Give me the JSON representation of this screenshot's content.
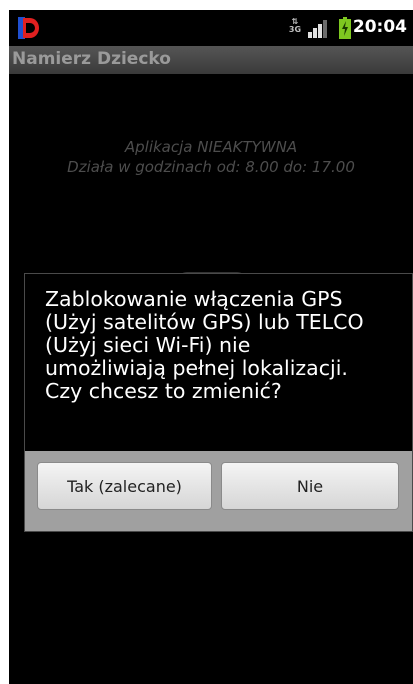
{
  "status_bar": {
    "clock": "20:04",
    "network_label": "3G",
    "icons": [
      "app-notification-icon",
      "3g-data-icon",
      "signal-strength-icon",
      "battery-charging-icon"
    ]
  },
  "title_bar": {
    "title": "Namierz Dziecko"
  },
  "app_content": {
    "status_line_1": "Aplikacja NIEAKTYWNA",
    "status_line_2": "Działa w godzinach od: 8.00 do: 17.00"
  },
  "dialog": {
    "message": "Zablokowanie włączenia GPS\n(Użyj satelitów GPS) lub TELCO\n(Użyj sieci Wi-Fi) nie\numożliwiają pełnej lokalizacji.\nCzy chcesz to zmienić?",
    "yes_label": "Tak (zalecane)",
    "no_label": "Nie"
  },
  "colors": {
    "screen_bg": "#000000",
    "title_bar_bg": "#4a4a4a",
    "title_text": "#9a9a9a",
    "dialog_buttonbar": "#a0a0a0",
    "button_bg": "#e8e8e8",
    "battery_green": "#7ec820",
    "app_icon_red": "#e02020",
    "app_icon_blue": "#2050d0"
  }
}
